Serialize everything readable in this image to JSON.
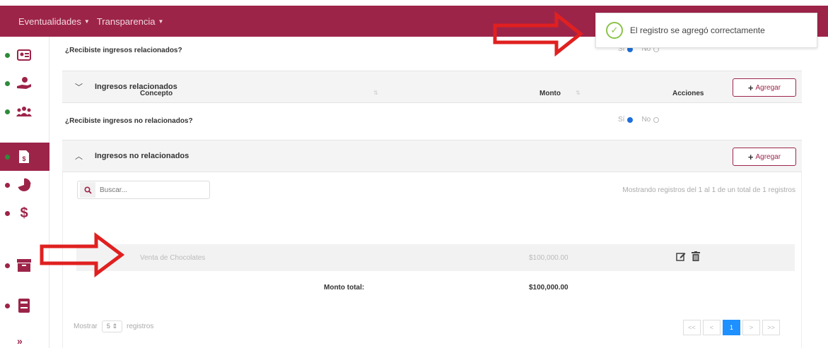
{
  "nav": {
    "items": [
      {
        "label": "Eventualidades"
      },
      {
        "label": "Transparencia"
      }
    ]
  },
  "sidebar": {
    "items": [
      {
        "icon": "id-card-icon",
        "status": "green"
      },
      {
        "icon": "hand-money-icon",
        "status": "green"
      },
      {
        "icon": "users-icon",
        "status": "green"
      },
      {
        "icon": "document-dollar-icon",
        "status": "green",
        "active": true
      },
      {
        "icon": "pie-chart-icon",
        "status": "red"
      },
      {
        "icon": "dollar-icon",
        "status": "red"
      },
      {
        "icon": "archive-icon",
        "status": "red"
      },
      {
        "icon": "notebook-icon",
        "status": "red"
      }
    ],
    "expand_label": "»"
  },
  "form": {
    "q1": {
      "question": "¿Recibiste ingresos relacionados?",
      "yes": "Sí",
      "no": "No"
    },
    "section1": {
      "title": "Ingresos relacionados",
      "add_label": "Agregar"
    },
    "q2": {
      "question": "¿Recibiste ingresos no relacionados?",
      "yes": "Sí",
      "no": "No"
    },
    "section2": {
      "title": "Ingresos no relacionados",
      "add_label": "Agregar"
    }
  },
  "table": {
    "search_placeholder": "Buscar...",
    "showing": "Mostrando registros del 1 al 1 de un total de 1 registros",
    "columns": [
      "Concepto",
      "Monto",
      "Acciones"
    ],
    "rows": [
      {
        "concepto": "Venta de Chocolates",
        "monto": "$100,000.00"
      }
    ],
    "total_label": "Monto total:",
    "total_value": "$100,000.00",
    "show_prefix": "Mostrar",
    "page_size": "5",
    "show_suffix": "registros",
    "pager": [
      "<<",
      "<",
      "1",
      ">",
      ">>"
    ]
  },
  "toast": {
    "message": "El registro se agregó correctamente"
  },
  "colors": {
    "brand": "#9d2449",
    "ok": "#8bc34a",
    "status_green": "#2e8b3a",
    "status_red": "#9d2449"
  }
}
